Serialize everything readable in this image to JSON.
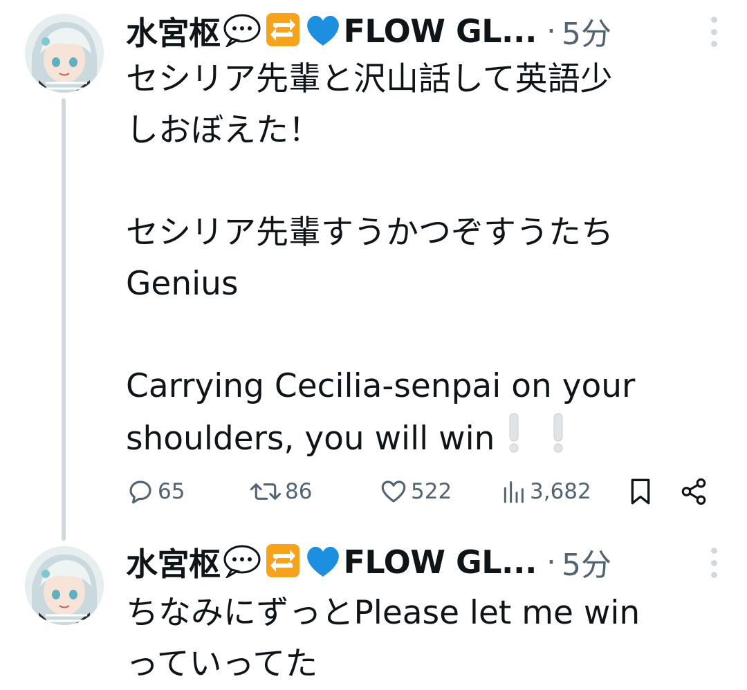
{
  "tweets": [
    {
      "author_name": "水宮枢",
      "author_badge": "FLOW GL...",
      "separator": "·",
      "time": "5分",
      "text": "セシリア先輩と沢山話して英語少\nしおぼえた！\n\nセシリア先輩すうかつぞすうたち\nGenius\n\nCarrying Cecilia-senpai on your\nshoulders, you will win",
      "emoji_after_name": [
        "speech-bubble",
        "repeat-button",
        "blue-heart"
      ],
      "text_trailing_emoji": "double-exclamation",
      "stats": {
        "replies": "65",
        "reposts": "86",
        "likes": "522",
        "views": "3,682"
      }
    },
    {
      "author_name": "水宮枢",
      "author_badge": "FLOW GL...",
      "separator": "·",
      "time": "5分",
      "text": "ちなみにずっとPlease let me win\nっていってた",
      "emoji_after_name": [
        "speech-bubble",
        "repeat-button",
        "blue-heart"
      ]
    }
  ],
  "colors": {
    "text": "#0f1419",
    "muted": "#536471",
    "thread_line": "#cfd9de",
    "blue_heart": "#1d8fe0",
    "repeat_orange": "#f7a21b"
  }
}
